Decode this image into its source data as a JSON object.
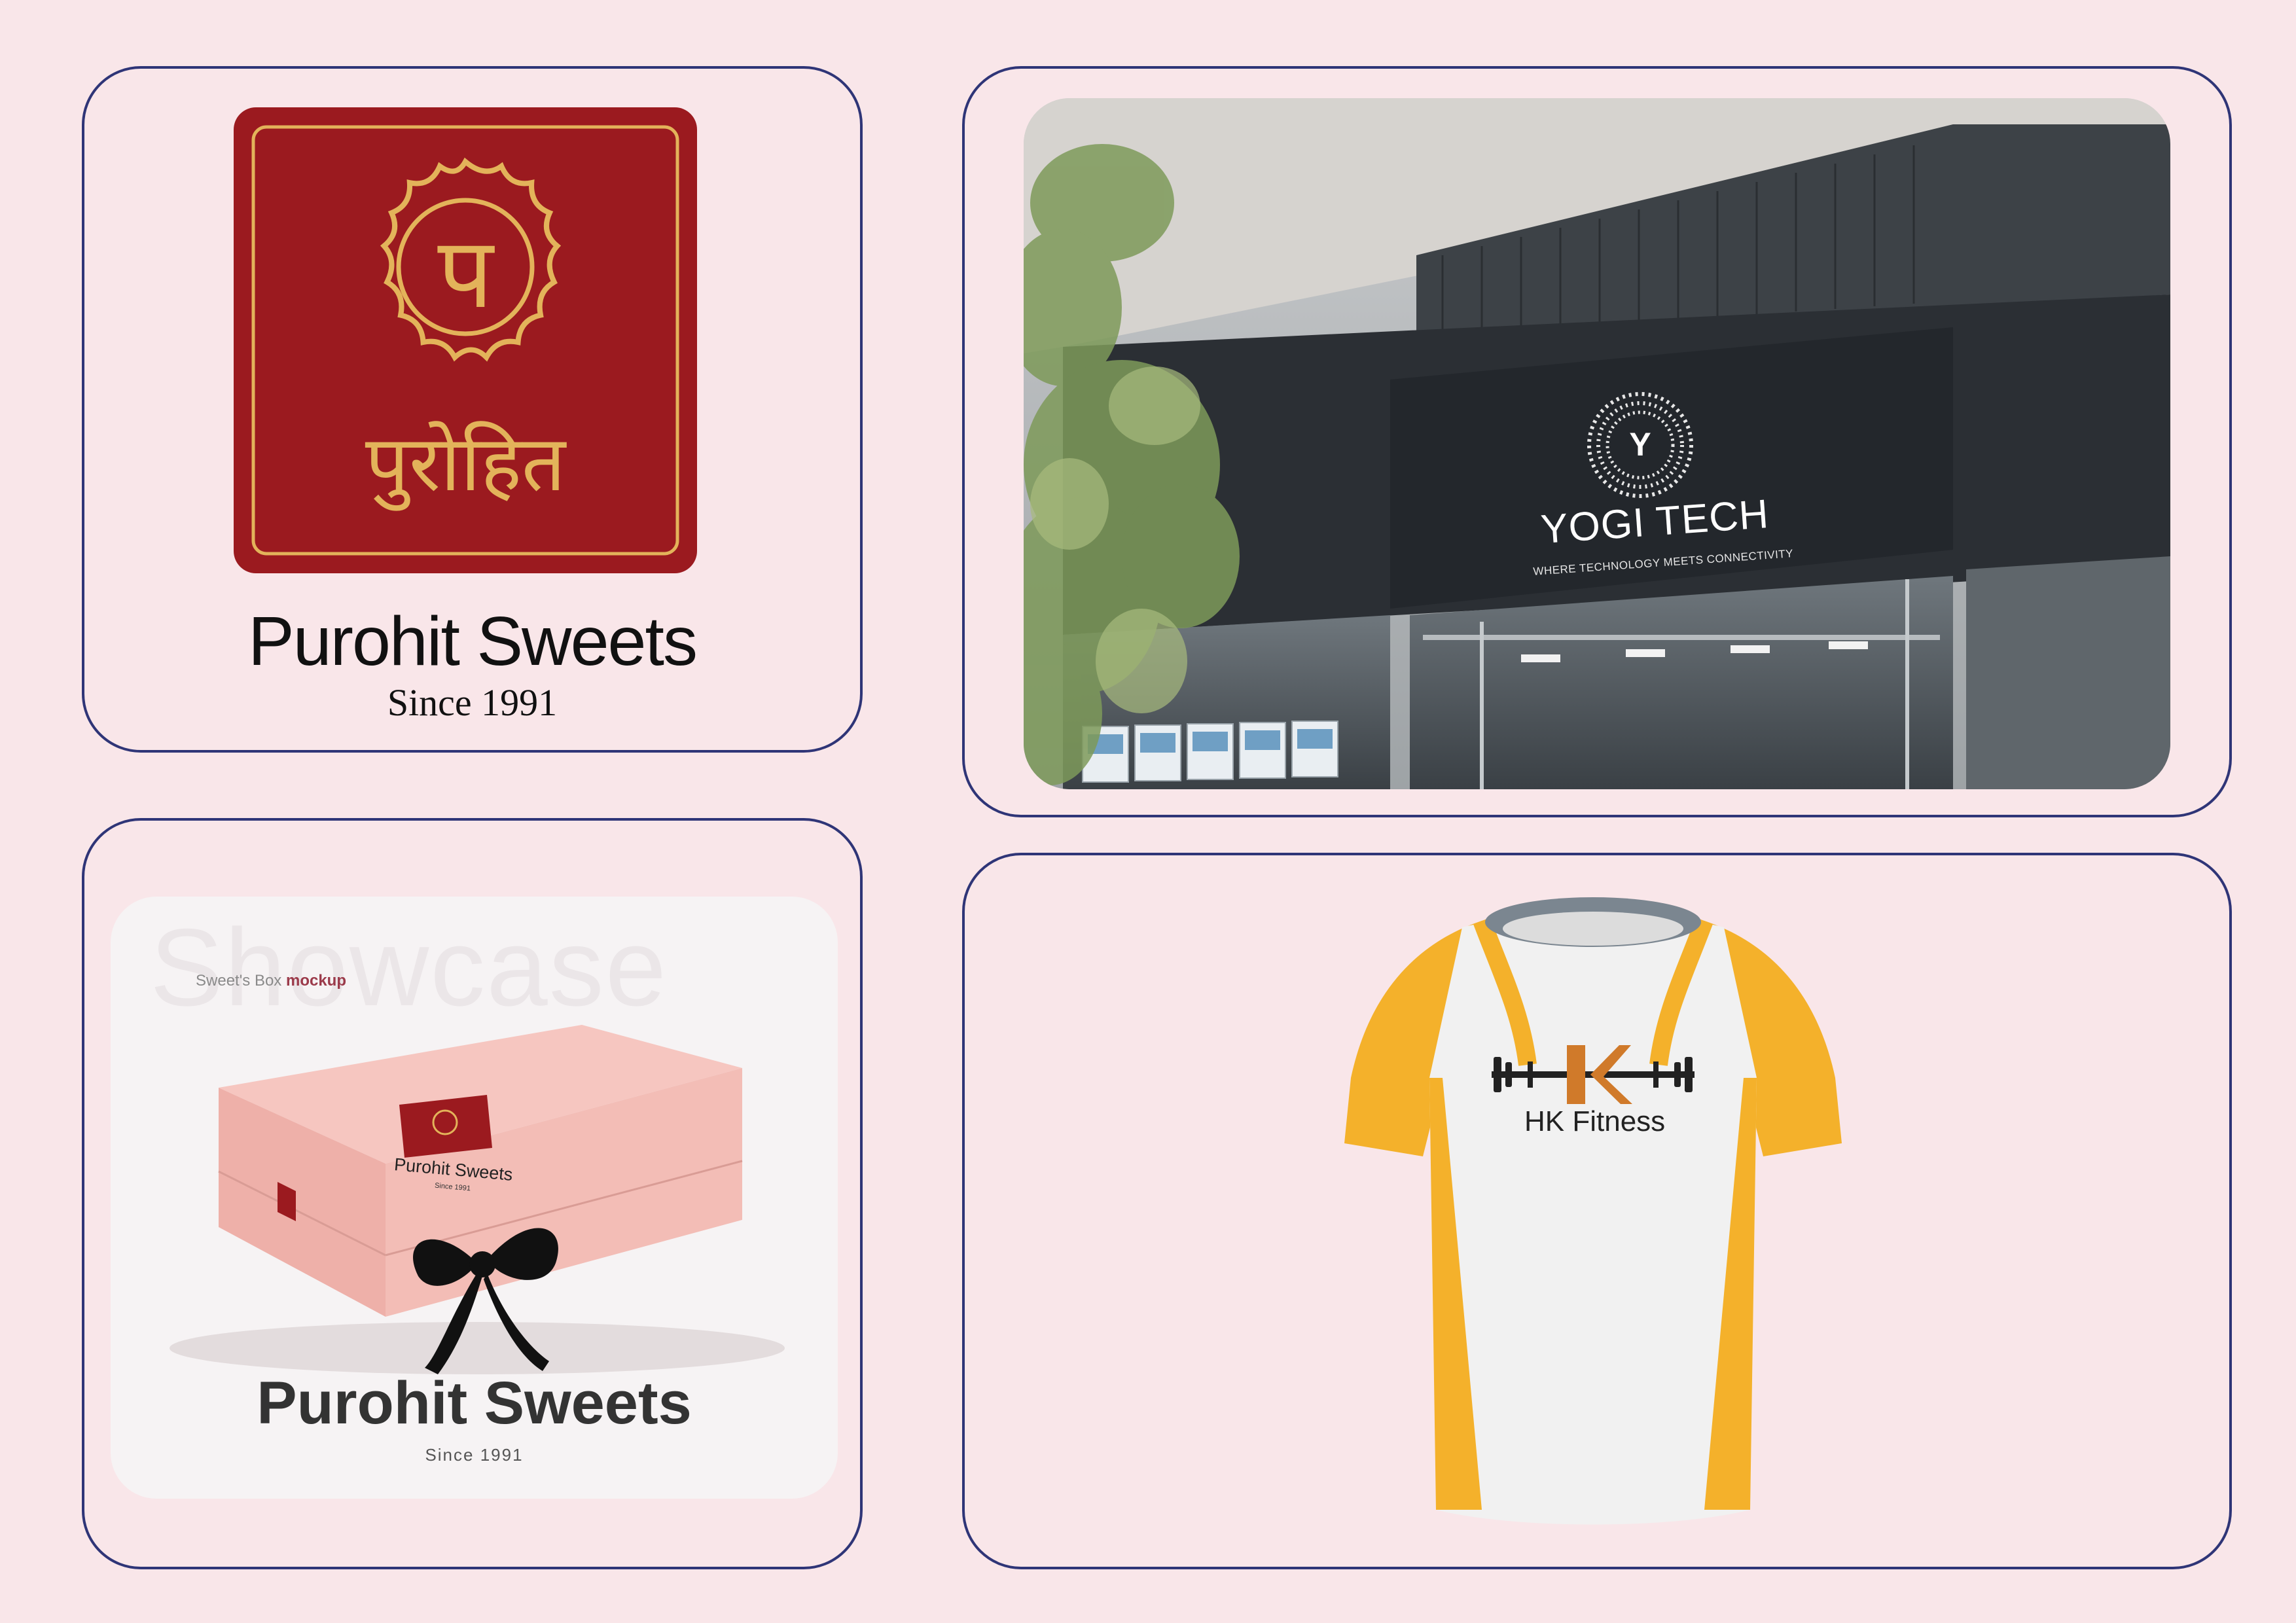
{
  "cards": {
    "purohit_logo": {
      "brand_name": "Purohit Sweets",
      "since": "Since 1991",
      "devanagari_mark": "पुरोहित",
      "emblem_letter": "प",
      "colors": {
        "tile": "#9b1a1f",
        "gold": "#e3b35a"
      }
    },
    "yogi_tech_storefront": {
      "title": "YOGI TECH",
      "tagline": "WHERE TECHNOLOGY MEETS CONNECTIVITY",
      "emblem_letter": "Y"
    },
    "sweet_box_mockup": {
      "watermark": "Showcase",
      "caption_prefix": "Sweet's Box ",
      "caption_highlight": "mockup",
      "box_brand": "Purohit Sweets",
      "box_since": "Since 1991",
      "title": "Purohit Sweets",
      "since": "Since 1991"
    },
    "hk_fitness_shirt": {
      "logo_letters": "HK",
      "brand_name": "HK Fitness",
      "colors": {
        "sleeve": "#f4b12b",
        "body": "#f1f1f1",
        "collar": "#7b8690",
        "accent": "#d07a2a"
      }
    }
  }
}
